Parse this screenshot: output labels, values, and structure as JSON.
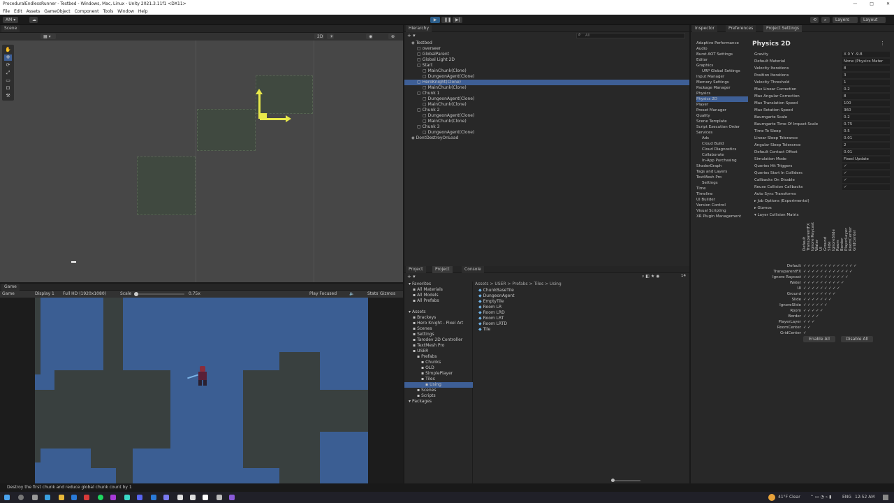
{
  "window": {
    "title": "ProceduralEndlessRunner - Testbed - Windows, Mac, Linux - Unity 2021.3.11f1 <DX11>",
    "controls": [
      "—",
      "□",
      "✕"
    ]
  },
  "menu": [
    "File",
    "Edit",
    "Assets",
    "GameObject",
    "Component",
    "Tools",
    "Window",
    "Help"
  ],
  "toolbar": {
    "account": "AM ▾",
    "layers": "Layers",
    "layout": "Layout",
    "play_icon": "play-icon",
    "pause_icon": "pause-icon",
    "step_icon": "step-icon"
  },
  "scene": {
    "tab": "Scene",
    "mode_2d": "2D"
  },
  "game": {
    "tab": "Game",
    "display_label": "Game",
    "display": "Display 1",
    "resolution": "Full HD (1920x1080)",
    "scale_label": "Scale",
    "scale_value": "0.75x",
    "play_mode": "Play Focused",
    "stats": "Stats",
    "gizmos": "Gizmos"
  },
  "hierarchy": {
    "tab": "Hierarchy",
    "search_placeholder": "All",
    "items": [
      {
        "label": "Testbed",
        "depth": 0
      },
      {
        "label": "overseer",
        "depth": 1
      },
      {
        "label": "GlobalParent",
        "depth": 1
      },
      {
        "label": "Global Light 2D",
        "depth": 1
      },
      {
        "label": "Start",
        "depth": 1
      },
      {
        "label": "MainChunk(Clone)",
        "depth": 2
      },
      {
        "label": "DungeonAgent(Clone)",
        "depth": 2
      },
      {
        "label": "HeroKnight(Clone)",
        "depth": 1
      },
      {
        "label": "MainChunk(Clone)",
        "depth": 2
      },
      {
        "label": "Chunk 1",
        "depth": 1
      },
      {
        "label": "DungeonAgent(Clone)",
        "depth": 2
      },
      {
        "label": "MainChunk(Clone)",
        "depth": 2
      },
      {
        "label": "Chunk 2",
        "depth": 1
      },
      {
        "label": "DungeonAgent(Clone)",
        "depth": 2
      },
      {
        "label": "MainChunk(Clone)",
        "depth": 2
      },
      {
        "label": "Chunk 3",
        "depth": 1
      },
      {
        "label": "DungeonAgent(Clone)",
        "depth": 2
      },
      {
        "label": "DontDestroyOnLoad",
        "depth": 0
      }
    ]
  },
  "project": {
    "tabs": [
      "Project",
      "Project",
      "Console"
    ],
    "breadcrumb": "Assets > USER > Prefabs > Tiles > Using",
    "badge": "14",
    "tree": [
      {
        "label": "Favorites",
        "depth": 0
      },
      {
        "label": "All Materials",
        "depth": 1
      },
      {
        "label": "All Models",
        "depth": 1
      },
      {
        "label": "All Prefabs",
        "depth": 1
      },
      {
        "label": "",
        "depth": 0
      },
      {
        "label": "Assets",
        "depth": 0
      },
      {
        "label": "Brackeys",
        "depth": 1
      },
      {
        "label": "Hero Knight - Pixel Art",
        "depth": 1
      },
      {
        "label": "Scenes",
        "depth": 1
      },
      {
        "label": "Settings",
        "depth": 1
      },
      {
        "label": "Tarodev 2D Controller",
        "depth": 1
      },
      {
        "label": "TextMesh Pro",
        "depth": 1
      },
      {
        "label": "USER",
        "depth": 1
      },
      {
        "label": "Prefabs",
        "depth": 2
      },
      {
        "label": "Chunks",
        "depth": 3
      },
      {
        "label": "OLD",
        "depth": 3
      },
      {
        "label": "SimplePlayer",
        "depth": 3
      },
      {
        "label": "Tiles",
        "depth": 3
      },
      {
        "label": "Using",
        "depth": 4
      },
      {
        "label": "Scenes",
        "depth": 2
      },
      {
        "label": "Scripts",
        "depth": 2
      },
      {
        "label": "Packages",
        "depth": 0
      }
    ],
    "files": [
      "ChunkBaseTile",
      "DungeonAgent",
      "EmptyTile",
      "Room LR",
      "Room LRD",
      "Room LRT",
      "Room LRTD",
      "Tile"
    ]
  },
  "inspector": {
    "tabs": [
      "Inspector",
      "Preferences",
      "Project Settings"
    ],
    "nav": [
      "Adaptive Performance",
      "Audio",
      "Burst AOT Settings",
      "Editor",
      "Graphics",
      "URP Global Settings",
      "Input Manager",
      "Memory Settings",
      "Package Manager",
      "Physics",
      "Physics 2D",
      "Player",
      "Preset Manager",
      "Quality",
      "Scene Template",
      "Script Execution Order",
      "Services",
      "Ads",
      "Cloud Build",
      "Cloud Diagnostics",
      "Collaborate",
      "In-App Purchasing",
      "ShaderGraph",
      "Tags and Layers",
      "TextMesh Pro",
      "Settings",
      "Time",
      "Timeline",
      "UI Builder",
      "Version Control",
      "Visual Scripting",
      "XR Plugin Management"
    ],
    "section_title": "Physics 2D",
    "properties": [
      {
        "label": "Gravity",
        "value": "X 0    Y -9.8"
      },
      {
        "label": "Default Material",
        "value": "None (Physics Mater"
      },
      {
        "label": "Velocity Iterations",
        "value": "8"
      },
      {
        "label": "Position Iterations",
        "value": "3"
      },
      {
        "label": "Velocity Threshold",
        "value": "1"
      },
      {
        "label": "Max Linear Correction",
        "value": "0.2"
      },
      {
        "label": "Max Angular Correction",
        "value": "8"
      },
      {
        "label": "Max Translation Speed",
        "value": "100"
      },
      {
        "label": "Max Rotation Speed",
        "value": "360"
      },
      {
        "label": "Baumgarte Scale",
        "value": "0.2"
      },
      {
        "label": "Baumgarte Time Of Impact Scale",
        "value": "0.75"
      },
      {
        "label": "Time To Sleep",
        "value": "0.5"
      },
      {
        "label": "Linear Sleep Tolerance",
        "value": "0.01"
      },
      {
        "label": "Angular Sleep Tolerance",
        "value": "2"
      },
      {
        "label": "Default Contact Offset",
        "value": "0.01"
      },
      {
        "label": "Simulation Mode",
        "value": "Fixed Update"
      },
      {
        "label": "Queries Hit Triggers",
        "value": "✓"
      },
      {
        "label": "Queries Start In Colliders",
        "value": "✓"
      },
      {
        "label": "Callbacks On Disable",
        "value": "✓"
      },
      {
        "label": "Reuse Collision Callbacks",
        "value": "✓"
      },
      {
        "label": "Auto Sync Transforms",
        "value": ""
      },
      {
        "label": "▸ Job Options (Experimental)",
        "value": ""
      },
      {
        "label": "▸ Gizmos",
        "value": ""
      },
      {
        "label": "▾ Layer Collision Matrix",
        "value": ""
      }
    ],
    "matrix_rows": [
      "Default",
      "TransparentFX",
      "Ignore Raycast",
      "Water",
      "UI",
      "Ground",
      "Slide",
      "IgnoreSlide",
      "Room",
      "Border",
      "PlayerLayer",
      "RoomCenter",
      "GridCenter"
    ],
    "matrix_cols": [
      "Default",
      "TransparentFX",
      "Ignore Raycast",
      "Water",
      "UI",
      "Ground",
      "Slide",
      "IgnoreSlide",
      "Room",
      "Border",
      "PlayerLayer",
      "RoomCenter",
      "GridCenter"
    ],
    "enable_all": "Enable All",
    "disable_all": "Disable All"
  },
  "status": {
    "message": "Destroy the first chunk and reduce global chunk count by 1"
  },
  "taskbar": {
    "weather": "41°F Clear",
    "lang": "ENG",
    "time": "12:52 AM"
  },
  "colors": {
    "game_bg": "#3b5e93",
    "block": "#39403f",
    "selection": "#3e5f96",
    "accent_play": "#2b5d8a"
  }
}
